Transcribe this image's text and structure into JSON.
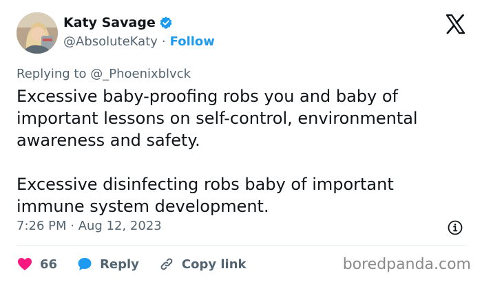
{
  "author": {
    "name": "Katy Savage",
    "handle": "@AbsoluteKaty",
    "separator": "·",
    "follow_label": "Follow"
  },
  "reply": {
    "prefix": "Replying to",
    "target": "@_Phoenixblvck"
  },
  "tweet": {
    "paragraph_1": "Excessive baby-proofing robs you and baby of important lessons on self-control, environmental awareness and safety.",
    "paragraph_2": "Excessive disinfecting robs baby of important immune system development.",
    "timestamp": "7:26 PM · Aug 12, 2023"
  },
  "actions": {
    "likes": "66",
    "reply_label": "Reply",
    "copy_label": "Copy link"
  },
  "watermark": "boredpanda.com",
  "icons": {
    "verified": "verified-badge-icon",
    "x_logo": "x-logo-icon",
    "info": "info-icon",
    "heart": "heart-icon",
    "reply": "speech-bubble-icon",
    "link": "link-icon"
  },
  "colors": {
    "accent": "#1d9bf0",
    "like": "#f91880",
    "muted": "#536471"
  }
}
